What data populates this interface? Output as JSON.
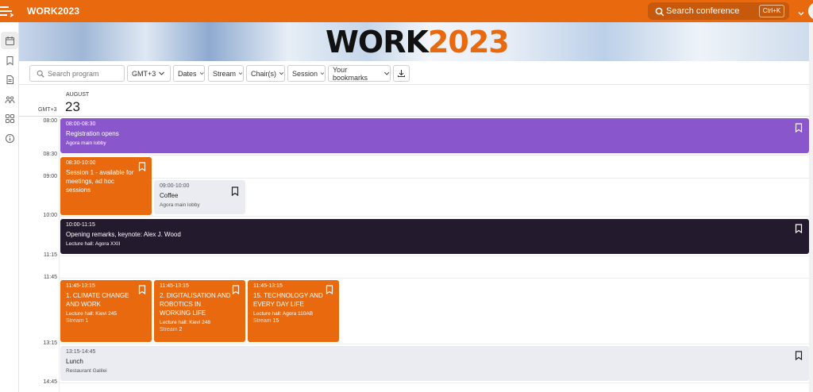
{
  "app": {
    "title": "WORK2023"
  },
  "topbar": {
    "search_placeholder": "Search conference",
    "shortcut": "Ctrl+K"
  },
  "banner": {
    "title_part1": "WORK",
    "title_part2": "2023"
  },
  "rail": {
    "items": [
      {
        "name": "calendar",
        "active": true
      },
      {
        "name": "bookmark"
      },
      {
        "name": "document"
      },
      {
        "name": "people"
      },
      {
        "name": "grid"
      },
      {
        "name": "info"
      }
    ]
  },
  "filters": {
    "search_placeholder": "Search program",
    "timezone": "GMT+3",
    "dates": "Dates",
    "stream": "Stream",
    "chairs": "Chair(s)",
    "session": "Session",
    "bookmarks": "Your bookmarks"
  },
  "calendar": {
    "month": "AUGUST",
    "day": "23",
    "timezone": "GMT+3",
    "time_labels": [
      "08:00",
      "08:30",
      "09:00",
      "10:00",
      "11:15",
      "11:45",
      "13:15",
      "14:45"
    ]
  },
  "events": [
    {
      "time": "08:00-08:30",
      "title": "Registration opens",
      "location": "Agora main lobby",
      "color": "#8a56cc"
    },
    {
      "time": "08:30-10:00",
      "title": "Session 1 - available for meetings, ad hoc sessions",
      "color": "#e8690e"
    },
    {
      "time": "09:00-10:00",
      "title": "Coffee",
      "location": "Agora main lobby",
      "color": "#ebebf2"
    },
    {
      "time": "10:00-11:15",
      "title": "Opening remarks, keynote: Alex J. Wood",
      "location": "Lecture hall: Agora XXII",
      "color": "#241a2e"
    },
    {
      "time": "11:45-13:15",
      "title": "1. CLIMATE CHANGE AND WORK",
      "location": "Lecture hall: Kievi 245",
      "stream_label": "Stream",
      "stream": "1",
      "color": "#e8690e"
    },
    {
      "time": "11:45-13:15",
      "title": "2. DIGITALISATION AND ROBOTICS IN WORKING LIFE",
      "location": "Lecture hall: Kievi 248",
      "stream_label": "Stream",
      "stream": "2",
      "color": "#e8690e"
    },
    {
      "time": "11:45-13:15",
      "title": "15. TECHNOLOGY AND EVERY DAY LIFE",
      "location": "Lecture hall: Agora 110AB",
      "stream_label": "Stream",
      "stream": "15",
      "color": "#e8690e"
    },
    {
      "time": "13:15-14:45",
      "title": "Lunch",
      "location": "Restaurant Galilei",
      "color": "#ebebf2"
    }
  ]
}
